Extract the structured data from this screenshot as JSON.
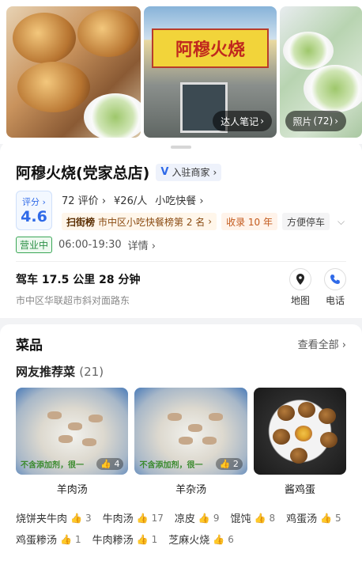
{
  "gallery": {
    "expert_notes_label": "达人笔记",
    "photos_label": "照片",
    "photos_count": "(72)",
    "shop_sign_text": "阿穆火烧"
  },
  "shop": {
    "name": "阿穆火烧(党家总店)",
    "merchant_label": "入驻商家",
    "score_label": "评分",
    "score": "4.6",
    "reviews": "72 评价",
    "price": "¥26/人",
    "category": "小吃快餐",
    "rank_icon": "扫街榜",
    "rank_text": "市中区小吃快餐榜第 2 名",
    "years_tag": "收录 10 年",
    "parking_tag": "方便停车",
    "status": "营业中",
    "hours": "06:00-19:30",
    "details_label": "详情"
  },
  "route": {
    "drive": "驾车 17.5 公里  28 分钟",
    "address": "市中区华联超市斜对面路东",
    "map_label": "地图",
    "phone_label": "电话"
  },
  "menu": {
    "title": "菜品",
    "view_all": "查看全部",
    "recommended_title": "网友推荐菜",
    "recommended_count": "(21)",
    "dishes": [
      {
        "name": "羊肉汤",
        "likes": "4",
        "image_text": "不含添加剂，很一"
      },
      {
        "name": "羊杂汤",
        "likes": "2",
        "image_text": "不含添加剂，很一"
      },
      {
        "name": "酱鸡蛋",
        "likes": ""
      }
    ],
    "chips": [
      {
        "name": "烧饼夹牛肉",
        "count": "3"
      },
      {
        "name": "牛肉汤",
        "count": "17"
      },
      {
        "name": "凉皮",
        "count": "9"
      },
      {
        "name": "馄饨",
        "count": "8"
      },
      {
        "name": "鸡蛋汤",
        "count": "5"
      },
      {
        "name": "鸡蛋糁汤",
        "count": "1"
      },
      {
        "name": "牛肉糁汤",
        "count": "1"
      },
      {
        "name": "芝麻火烧",
        "count": "6"
      }
    ]
  },
  "colors": {
    "accent_blue": "#2f6ae8",
    "open_green": "#2b8f45",
    "rank_orange": "#c35a1d"
  }
}
